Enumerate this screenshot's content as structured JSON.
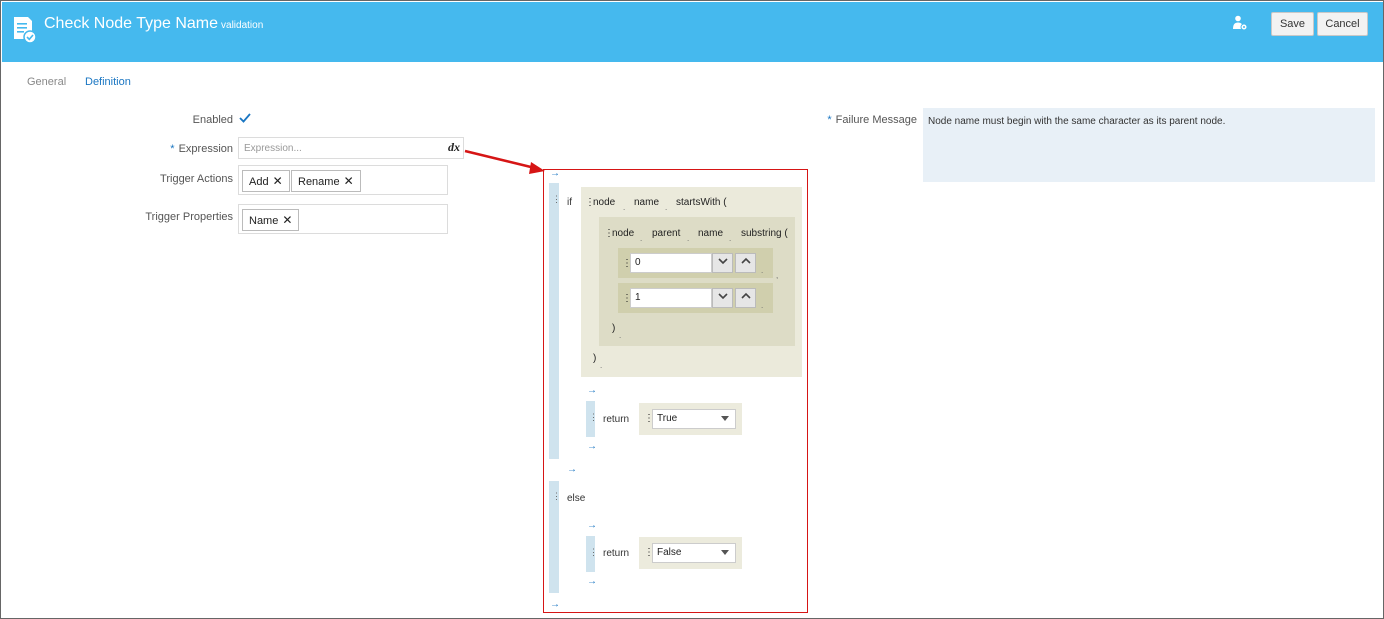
{
  "header": {
    "title": "Check Node Type Name",
    "subtitle": "validation",
    "save_label": "Save",
    "cancel_label": "Cancel"
  },
  "tabs": [
    {
      "label": "General",
      "active": false
    },
    {
      "label": "Definition",
      "active": true
    }
  ],
  "form": {
    "enabled_label": "Enabled",
    "enabled_checked": true,
    "expression_label": "Expression",
    "expression_placeholder": "Expression...",
    "expression_button": "dx",
    "trigger_actions_label": "Trigger Actions",
    "trigger_actions": [
      "Add",
      "Rename"
    ],
    "trigger_properties_label": "Trigger Properties",
    "trigger_properties": [
      "Name"
    ],
    "failure_message_label": "Failure Message",
    "failure_message": "Node name must begin with the same character as its parent node."
  },
  "editor": {
    "if_keyword": "if",
    "else_keyword": "else",
    "return_keyword": "return",
    "outer_tokens": [
      "node",
      "name",
      "startsWith ("
    ],
    "inner_tokens": [
      "node",
      "parent",
      "name",
      "substring ("
    ],
    "arg1": "0",
    "arg2": "1",
    "inner_close": ")",
    "outer_close": ")",
    "if_return_value": "True",
    "else_return_value": "False"
  },
  "colors": {
    "header_bg": "#45b9ee",
    "accent": "#1a76c2",
    "highlight_box": "#d61515"
  }
}
